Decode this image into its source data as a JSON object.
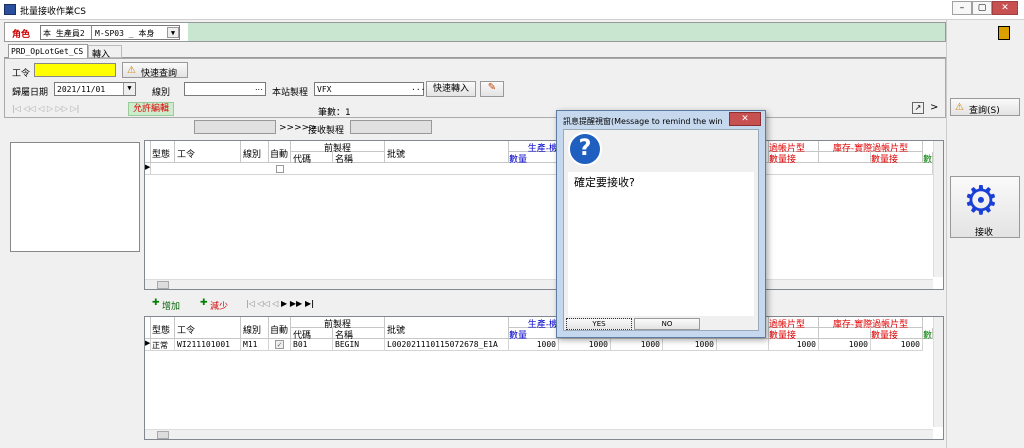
{
  "window": {
    "title": "批量接收作業CS"
  },
  "role": {
    "label": "角色",
    "value": "本 生產員2",
    "dept": "M-SP03 _ 本身"
  },
  "tabs": [
    "PRD_OpLotGet_CS",
    "轉入"
  ],
  "form": {
    "workorder_label": "工令",
    "quick_query": "快速查詢",
    "date_label": "歸屬日期",
    "date_value": "2021/11/01",
    "line_label": "線別",
    "process_label": "本站製程",
    "process_value": "VFX",
    "quick_import": "快速轉入",
    "allow_edit": "允許編輯",
    "count_label": "筆數：1",
    "arrows": ">>>>>",
    "receive_process": "接收製程"
  },
  "right_panel": {
    "query": "查詢(S)",
    "receive": "接收"
  },
  "grid_headers": {
    "type": "型態",
    "workorder": "工令",
    "line": "線別",
    "auto": "自動",
    "prev_process": "前製程",
    "code": "代碼",
    "name": "名稱",
    "lot": "批號",
    "produce": "生產-機",
    "qty": "數量",
    "over_chip": "過帳片型",
    "over_qty": "數量接",
    "stock_chip": "庫存-實際過帳片型",
    "stock_qty": "數量接",
    "last_col": "數"
  },
  "detail_toolbar": {
    "add": "增加",
    "reduce": "減少"
  },
  "detail_row": {
    "type": "正常",
    "workorder": "WI211101001",
    "line": "M11",
    "code": "B01",
    "name": "BEGIN",
    "lot": "L002021110115072678_E1A",
    "values": [
      "1000",
      "1000",
      "1000",
      "1000",
      "1000",
      "1000",
      "1000"
    ]
  },
  "dialog": {
    "title": "訊息提醒視窗(Message to remind the wind...",
    "message": "確定要接收?",
    "yes": "YES",
    "no": "NO"
  },
  "colors": {
    "role_bar": "#c8e6d0",
    "workorder_input": "#ffff00",
    "allow_edit_bg": "#cdeccd",
    "allow_edit_text": "#e00000",
    "close_button": "#c75050"
  }
}
